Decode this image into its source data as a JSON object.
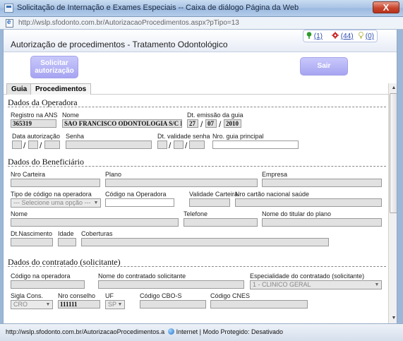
{
  "window": {
    "title": "Solicitação de Internação e Exames Especiais -- Caixa de diálogo Página da Web",
    "close_label": "X",
    "url": "http://wslp.sfodonto.com.br/AutorizacaoProcedimentos.aspx?pTipo=13"
  },
  "header": {
    "page_title": "Autorização de procedimentos - Tratamento Odontológico",
    "notifications": [
      {
        "icon": "green-pin-icon",
        "label": "(1)",
        "color": "#2e9b2e"
      },
      {
        "icon": "red-alert-icon",
        "label": "(44)",
        "color": "#c81e1e"
      },
      {
        "icon": "bulb-icon",
        "label": "(0)",
        "color": "#bfbf60"
      }
    ]
  },
  "actions": {
    "solicitar": "Solicitar autorização",
    "sair": "Sair"
  },
  "tabs": [
    "Guia",
    "Procedimentos"
  ],
  "operadora": {
    "section_title": "Dados da Operadora",
    "registro_label": "Registro na ANS",
    "registro_value": "365319",
    "nome_label": "Nome",
    "nome_value": "SAO FRANCISCO ODONTOLOGIA S/C LTDA",
    "emissao_label": "Dt. emissão da guia",
    "emissao_dia": "27",
    "emissao_mes": "07",
    "emissao_ano": "2010",
    "data_aut_label": "Data autorização",
    "senha_label": "Senha",
    "validade_label": "Dt. validade senha",
    "guia_label": "Nro. guia principal"
  },
  "beneficiario": {
    "section_title": "Dados do Beneficiário",
    "carteira_label": "Nro Carteira",
    "plano_label": "Plano",
    "empresa_label": "Empresa",
    "tipo_codigo_label": "Tipo de código na operadora",
    "tipo_codigo_value": "--- Selecione uma opção ---",
    "codigo_label": "Código na Operadora",
    "validade_label": "Validade Carteira",
    "cns_label": "Nro cartão nacional saúde",
    "nome_label": "Nome",
    "telefone_label": "Telefone",
    "titular_label": "Nome do titular do plano",
    "nascimento_label": "Dt.Nascimento",
    "idade_label": "Idade",
    "coberturas_label": "Coberturas"
  },
  "contratado": {
    "section_title": "Dados do contratado (solicitante)",
    "codigo_label": "Código na operadora",
    "nome_label": "Nome do contratado solicitante",
    "especialidade_label": "Especialidade do contratado (solicitante)",
    "especialidade_value": "1 - CLINICO GERAL",
    "sigla_label": "Sigla Cons.",
    "sigla_value": "CRO",
    "conselho_label": "Nro conselho",
    "conselho_value": "111111",
    "uf_label": "UF",
    "uf_value": "SP",
    "cbo_label": "Código CBO-S",
    "cnes_label": "Código CNES"
  },
  "statusbar": {
    "url": "http://wslp.sfodonto.com.br/AutorizacaoProcedimentos.a",
    "zone": "Internet | Modo Protegido: Desativado"
  }
}
